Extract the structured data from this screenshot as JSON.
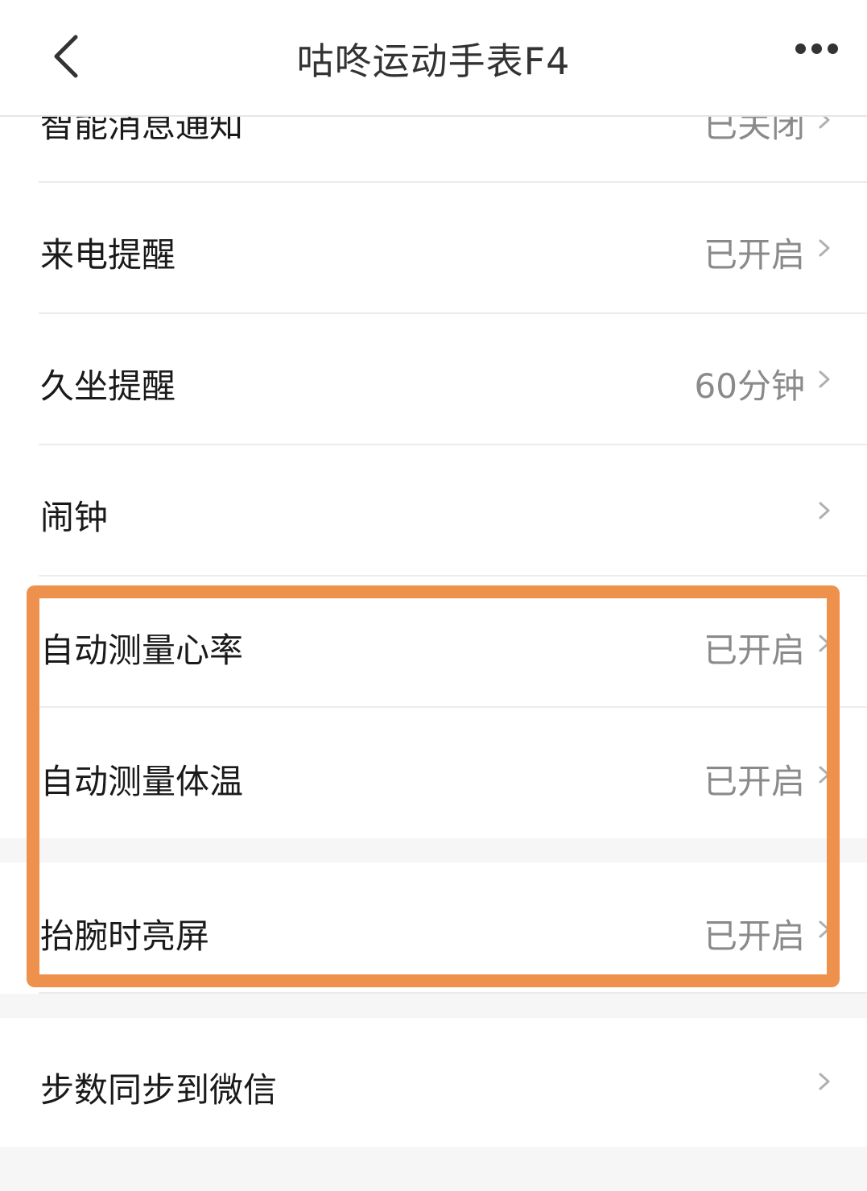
{
  "header": {
    "title": "咕咚运动手表F4",
    "back_icon": "chevron-left-icon",
    "more_icon": "more-dots-icon"
  },
  "rows": [
    {
      "label": "智能消息通知",
      "value": "已关闭"
    },
    {
      "label": "来电提醒",
      "value": "已开启"
    },
    {
      "label": "久坐提醒",
      "value": "60分钟"
    },
    {
      "label": "闹钟",
      "value": ""
    },
    {
      "label": "自动测量心率",
      "value": "已开启"
    },
    {
      "label": "自动测量体温",
      "value": "已开启"
    },
    {
      "label": "抬腕时亮屏",
      "value": "已开启"
    },
    {
      "label": "步数同步到微信",
      "value": ""
    }
  ],
  "colors": {
    "highlight": "#ee914d",
    "label": "#1a1a1a",
    "value": "#8a8a8a",
    "chevron": "#b0b0b0",
    "section_gap": "#f6f6f6"
  }
}
